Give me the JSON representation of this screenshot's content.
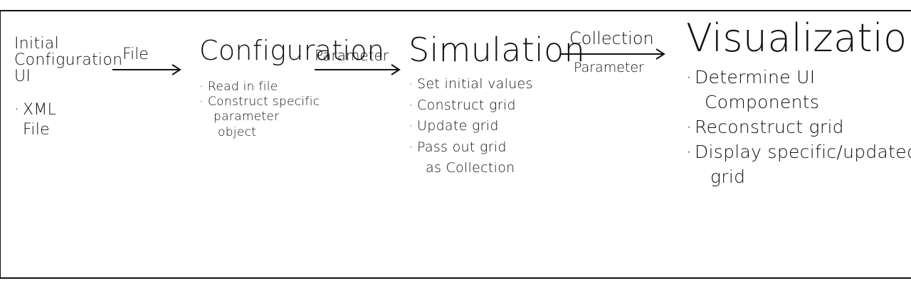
{
  "diagram": {
    "stages": [
      {
        "title_lines": [
          "Initial",
          "Configuration",
          "UI"
        ],
        "bullets": [
          "XML",
          "File"
        ]
      },
      {
        "title_lines": [
          "Configuration"
        ],
        "bullets": [
          "Read in file",
          "Construct specific",
          "parameter",
          "object"
        ]
      },
      {
        "title_lines": [
          "Simulation"
        ],
        "bullets": [
          "Set initial values",
          "Construct grid",
          "Update grid",
          "Pass out grid",
          "as Collection"
        ]
      },
      {
        "title_lines": [
          "Visualization"
        ],
        "bullets": [
          "Determine UI",
          "Components",
          "Reconstruct grid",
          "Display specific/updated",
          "grid"
        ]
      }
    ],
    "arrows": [
      {
        "label": "File"
      },
      {
        "label": "Parameter"
      },
      {
        "label_top": "Collection",
        "label_bottom": "Parameter"
      }
    ]
  }
}
